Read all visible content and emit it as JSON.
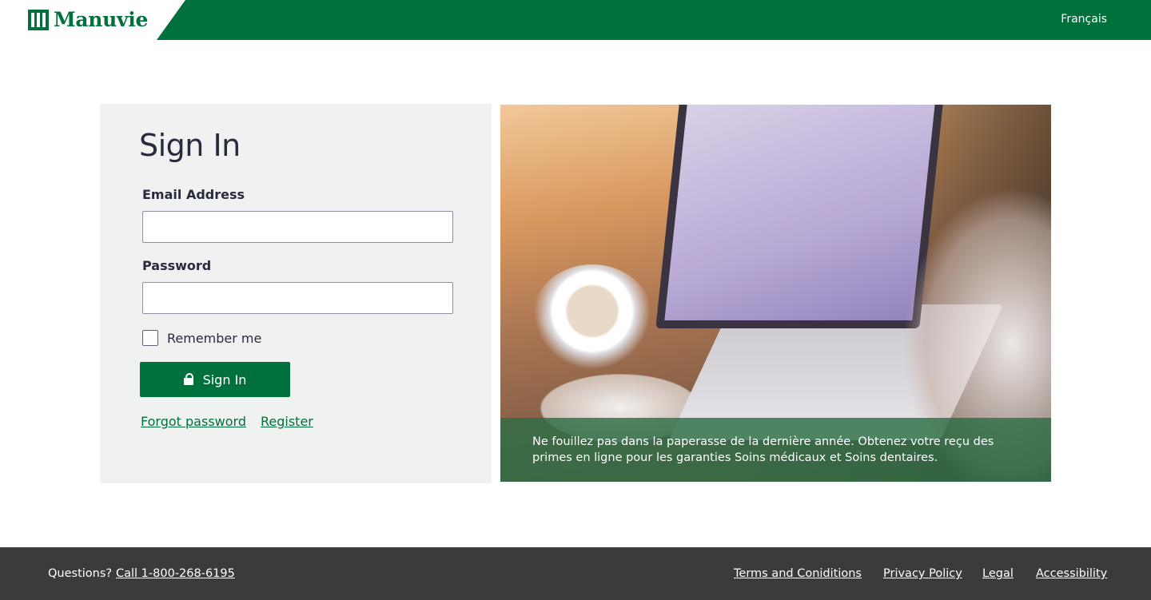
{
  "header": {
    "brand": "Manuvie",
    "language_link": "Français",
    "brand_color": "#00703c"
  },
  "signin": {
    "title": "Sign In",
    "email_label": "Email Address",
    "email_value": "",
    "password_label": "Password",
    "password_value": "",
    "remember_label": "Remember me",
    "remember_checked": false,
    "button_label": "Sign In",
    "button_icon": "lock-icon",
    "forgot_label": "Forgot password",
    "register_label": "Register"
  },
  "hero": {
    "caption": "Ne fouillez pas dans la paperasse de la dernière année. Obtenez votre reçu des primes en ligne pour les garanties Soins médicaux et Soins dentaires."
  },
  "footer": {
    "question_label": "Questions?",
    "call_link": "Call 1-800-268-6195",
    "links": [
      "Terms and Coniditions",
      "Privacy Policy",
      "Legal",
      "Accessibility"
    ],
    "background": "#3b3b3b"
  }
}
